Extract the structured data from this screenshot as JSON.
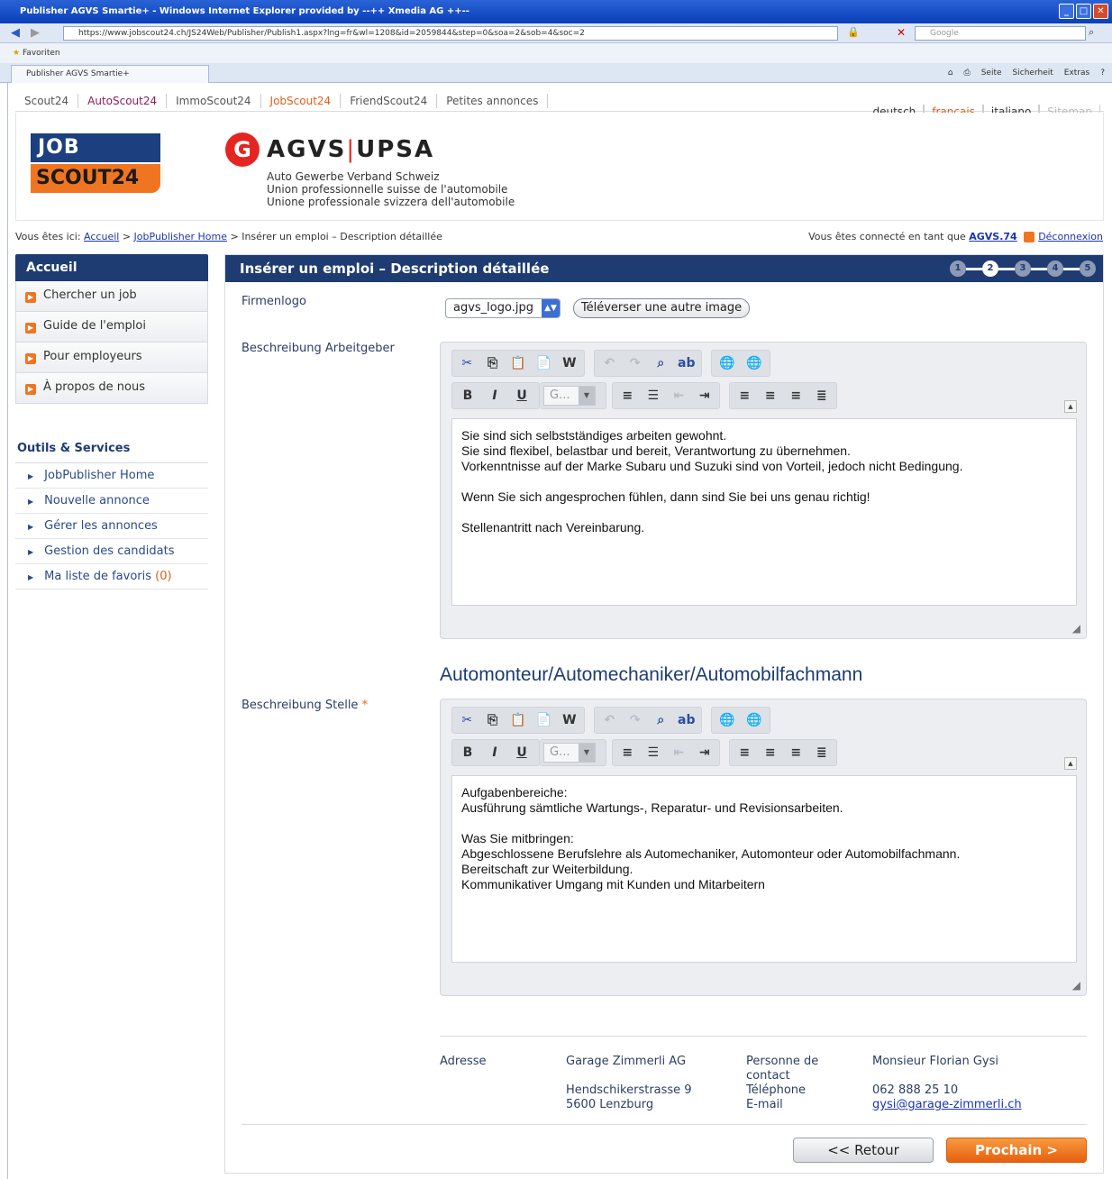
{
  "browser": {
    "title": "Publisher AGVS Smartie+ - Windows Internet Explorer provided by --++ Xmedia AG ++--",
    "url": "https://www.jobscout24.ch/JS24Web/Publisher/Publish1.aspx?lng=fr&wl=1208&id=2059844&step=0&soa=2&sob=4&soc=2",
    "search_placeholder": "Google",
    "favorites": "Favoriten",
    "tab": "Publisher AGVS Smartie+",
    "tools": [
      "Seite",
      "Sicherheit",
      "Extras"
    ]
  },
  "topnav": {
    "items": [
      "Scout24",
      "AutoScout24",
      "ImmoScout24",
      "JobScout24",
      "FriendScout24",
      "Petites annonces"
    ],
    "langs": [
      "deutsch",
      "français",
      "italiano",
      "Sitemap"
    ]
  },
  "header": {
    "logo_top": "JOB",
    "logo_bottom": "SCOUT24",
    "agvs_symbol": "G",
    "agvs_left": "AGVS",
    "agvs_sep": "|",
    "agvs_right": "UPSA",
    "agvs_lines": [
      "Auto Gewerbe Verband Schweiz",
      "Union professionnelle suisse de l'automobile",
      "Unione professionale svizzera dell'automobile"
    ]
  },
  "breadcrumb": {
    "prefix": "Vous êtes ici:",
    "home": "Accueil",
    "sep": ">",
    "jp": "JobPublisher Home",
    "current": "Insérer un emploi – Description détaillée"
  },
  "login": {
    "text": "Vous êtes connecté en tant que",
    "user": "AGVS.74",
    "logout": "Déconnexion"
  },
  "sidebar": {
    "title": "Accueil",
    "items": [
      "Chercher un job",
      "Guide de l'emploi",
      "Pour employeurs",
      "À propos de nous"
    ],
    "outils_title": "Outils & Services",
    "outils": [
      "JobPublisher Home",
      "Nouvelle annonce",
      "Gérer les annonces",
      "Gestion des candidats",
      "Ma liste de favoris"
    ],
    "fav_count": "(0)"
  },
  "main": {
    "title": "Insérer un emploi – Description détaillée",
    "steps": [
      "1",
      "2",
      "3",
      "4",
      "5"
    ],
    "current_step": 2,
    "firmenlogo_label": "Firmenlogo",
    "logo_file": "agvs_logo.jpg",
    "upload_button": "Téléverser une autre image",
    "arbeitgeber_label": "Beschreibung Arbeitgeber",
    "arbeitgeber_text": [
      "Sie sind sich selbstständiges arbeiten gewohnt.",
      "Sie sind flexibel, belastbar und bereit, Verantwortung zu übernehmen.",
      "Vorkenntnisse auf der Marke Subaru und Suzuki sind von Vorteil, jedoch nicht Bedingung.",
      "",
      "Wenn Sie sich angesprochen fühlen, dann sind Sie bei uns genau richtig!",
      "",
      "Stellenantritt nach Vereinbarung."
    ],
    "job_title": "Automonteur/Automechaniker/Automobilfachmann",
    "stelle_label": "Beschreibung Stelle",
    "required_mark": "*",
    "stelle_text": [
      "Aufgabenbereiche:",
      "Ausführung sämtliche Wartungs-, Reparatur- und Revisionsarbeiten.",
      "",
      "Was Sie mitbringen:",
      "Abgeschlossene Berufslehre als Automechaniker, Automonteur oder Automobilfachmann.",
      "Bereitschaft zur Weiterbildung.",
      "Kommunikativer Umgang mit Kunden und Mitarbeitern"
    ],
    "font_select": "G...",
    "address_label": "Adresse",
    "company": "Garage Zimmerli AG",
    "street": "Hendschikerstrasse 9",
    "city": "5600 Lenzburg",
    "contact_label": "Personne de contact",
    "phone_label": "Téléphone",
    "email_label": "E-mail",
    "contact_name": "Monsieur Florian Gysi",
    "phone": "062 888 25 10",
    "email": "gysi@garage-zimmerli.ch",
    "back_button": "<< Retour",
    "next_button": "Prochain >"
  }
}
